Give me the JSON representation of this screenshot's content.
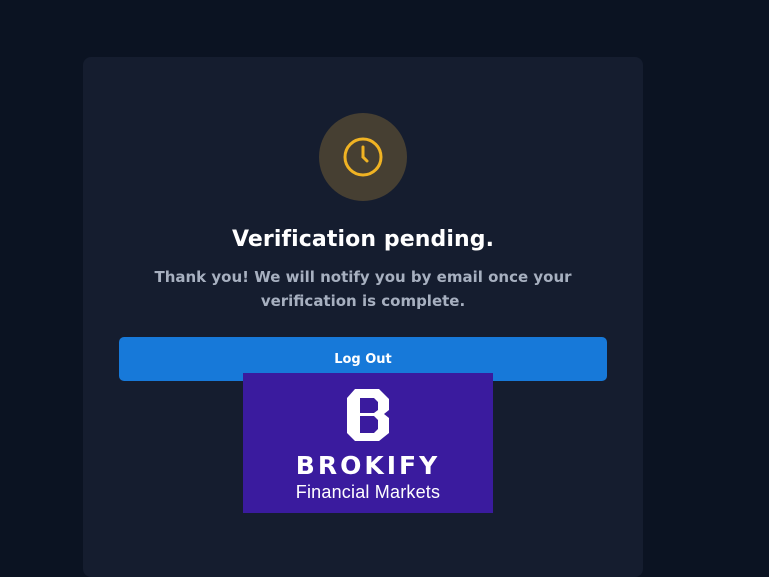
{
  "verification": {
    "status_icon": "clock-icon",
    "title": "Verification pending.",
    "message": "Thank you! We will notify you by email once your verification is complete.",
    "logout_label": "Log Out"
  },
  "brand": {
    "name": "BROKIFY",
    "tagline": "Financial Markets"
  },
  "colors": {
    "page_background": "#0b1322",
    "card_background": "#151d2f",
    "icon_background": "#463f32",
    "icon_accent": "#f0b323",
    "button": "#1779d9",
    "brand_background": "#3a1b9e"
  }
}
